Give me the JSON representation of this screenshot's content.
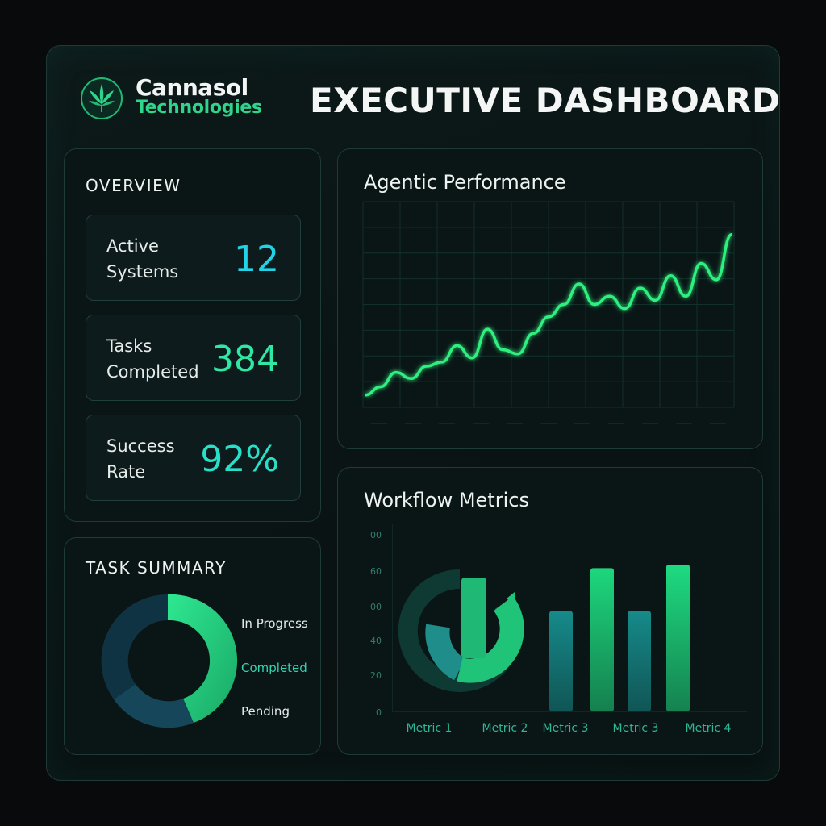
{
  "brand": {
    "name_line1": "Cannasol",
    "name_line2": "Technologies",
    "logo_icon": "cannabis-leaf-icon"
  },
  "page": {
    "title": "EXECUTIVE DASHBOARD"
  },
  "overview": {
    "heading": "OVERVIEW",
    "stats": [
      {
        "label": "Active\nSystems",
        "value": "12",
        "color": "#22d3e6"
      },
      {
        "label": "Tasks\nCompleted",
        "value": "384",
        "color": "#2ee8a4"
      },
      {
        "label": "Success\nRate",
        "value": "92%",
        "color": "#28e0c8"
      }
    ]
  },
  "task_summary": {
    "heading": "TASK SUMMARY",
    "legend": [
      {
        "label": "In Progress",
        "color": "#e6ecea"
      },
      {
        "label": "Completed",
        "color": "#2fd5b0"
      },
      {
        "label": "Pending",
        "color": "#e6ecea"
      }
    ]
  },
  "agentic": {
    "title": "Agentic Performance"
  },
  "workflow": {
    "title": "Workflow Metrics",
    "y_ticks": [
      "00",
      "60",
      "00",
      "40",
      "20",
      "0"
    ],
    "x_labels": [
      "Metric 1",
      "Metric 2",
      "Metric 3",
      "Metric 3",
      "Metric 4"
    ]
  },
  "chart_data": [
    {
      "type": "line",
      "title": "Agentic Performance",
      "x": [
        0,
        1,
        2,
        3,
        4,
        5,
        6,
        7,
        8,
        9,
        10,
        11,
        12,
        13,
        14,
        15,
        16,
        17,
        18,
        19,
        20,
        21,
        22,
        23,
        24
      ],
      "y": [
        6,
        10,
        17,
        14,
        20,
        22,
        30,
        24,
        38,
        28,
        26,
        36,
        44,
        50,
        60,
        50,
        54,
        48,
        58,
        52,
        64,
        54,
        70,
        62,
        84
      ],
      "ylim": [
        0,
        100
      ],
      "grid": true,
      "color": "#2ef07f"
    },
    {
      "type": "pie",
      "title": "TASK SUMMARY",
      "labels": [
        "Completed",
        "Pending",
        "In Progress"
      ],
      "values": [
        45,
        20,
        35
      ],
      "colors": [
        "#22c57a",
        "#16465a",
        "#0f3342"
      ]
    },
    {
      "type": "bar",
      "title": "Workflow Metrics",
      "categories": [
        "Metric 2",
        "Metric 3",
        "Metric 3",
        "Metric 3",
        "Metric 4"
      ],
      "values": [
        68,
        56,
        80,
        56,
        82
      ],
      "colors": [
        "#1dc87a",
        "#168a8a",
        "#1dd77d",
        "#168a8a",
        "#1edb80"
      ],
      "ylim": [
        0,
        100
      ]
    }
  ]
}
